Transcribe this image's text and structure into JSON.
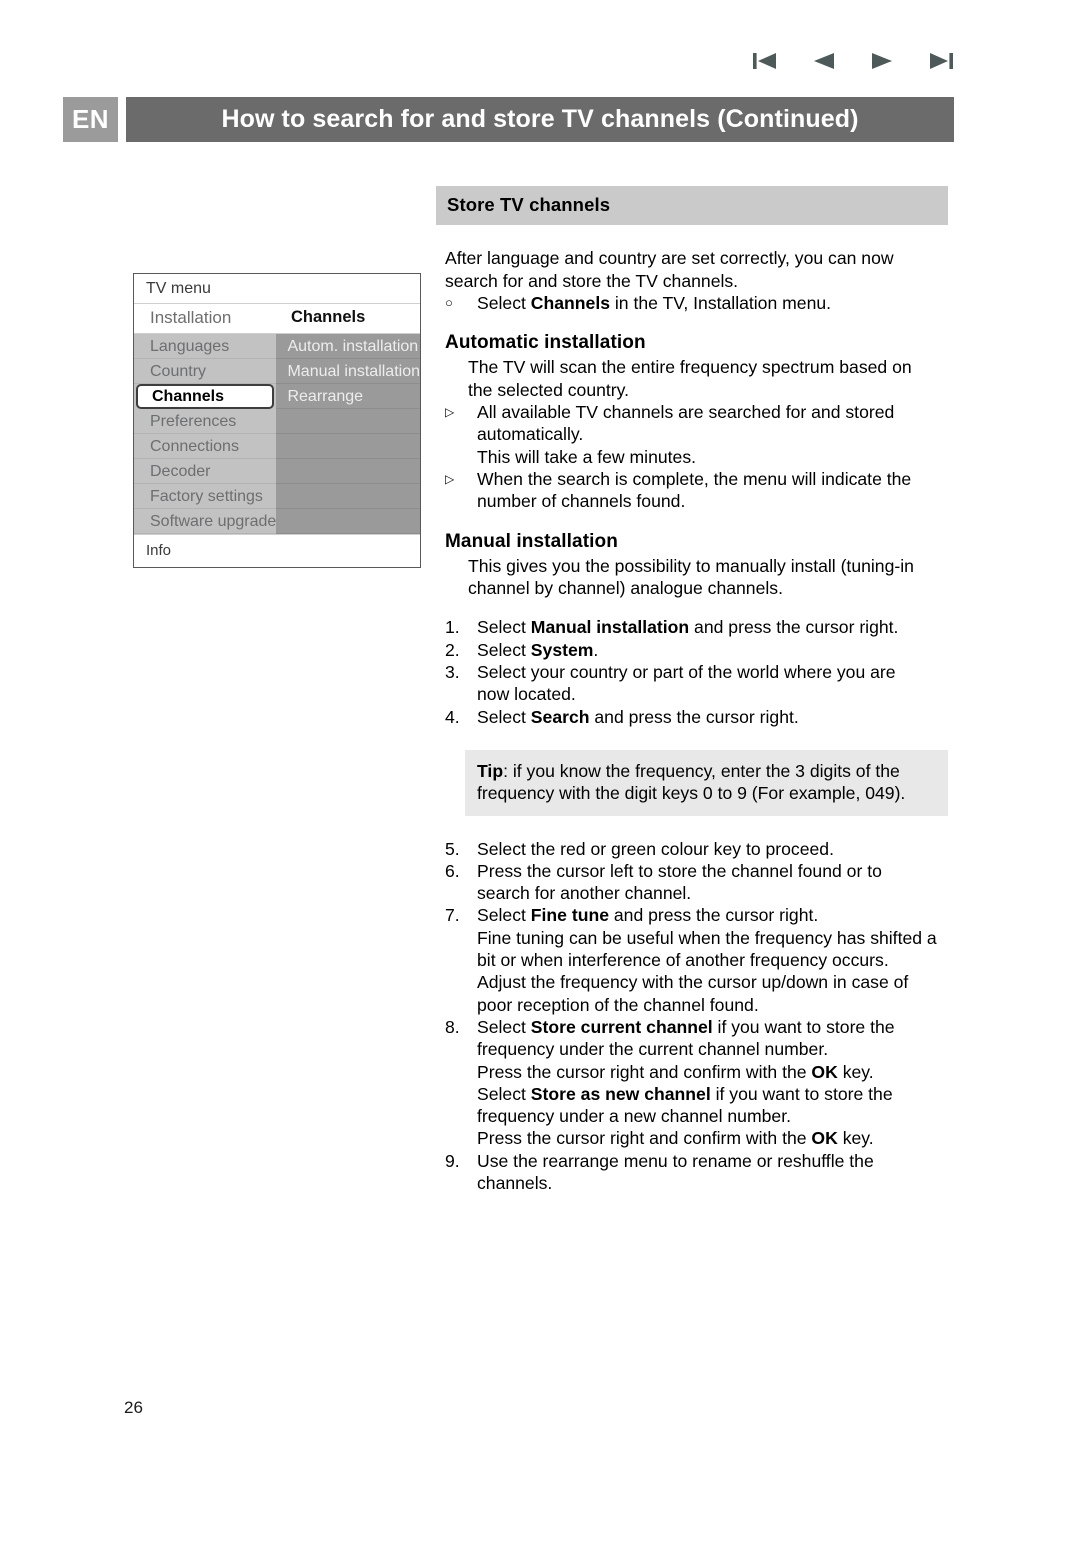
{
  "nav": {
    "items": [
      {
        "name": "first-page-icon",
        "label": "First page"
      },
      {
        "name": "previous-page-icon",
        "label": "Previous page"
      },
      {
        "name": "next-page-icon",
        "label": "Next page"
      },
      {
        "name": "last-page-icon",
        "label": "Last page"
      }
    ]
  },
  "header": {
    "language_badge": "EN",
    "title": "How to search for and store TV channels  (Continued)",
    "badge_color": "#9b9b9b",
    "bar_color": "#6b6b6b"
  },
  "tv_menu": {
    "title": "TV menu",
    "head_left": "Installation",
    "head_right": "Channels",
    "left_items": [
      {
        "label": "Languages",
        "selected": false
      },
      {
        "label": "Country",
        "selected": false
      },
      {
        "label": "Channels",
        "selected": true
      },
      {
        "label": "Preferences",
        "selected": false
      },
      {
        "label": "Connections",
        "selected": false
      },
      {
        "label": "Decoder",
        "selected": false
      },
      {
        "label": "Factory settings",
        "selected": false
      },
      {
        "label": "Software upgrade",
        "selected": false
      }
    ],
    "right_items": [
      {
        "label": "Autom. installation"
      },
      {
        "label": "Manual installation"
      },
      {
        "label": "Rearrange"
      },
      {
        "label": ""
      },
      {
        "label": ""
      },
      {
        "label": ""
      },
      {
        "label": ""
      },
      {
        "label": ""
      }
    ],
    "info": "Info",
    "left_bg": "#c2c2c2",
    "right_bg": "#9a9a9a"
  },
  "content": {
    "section_title": "Store TV channels",
    "section_bar_color": "#cacaca",
    "intro_line1": "After language and country are set correctly, you can now",
    "intro_line2": "search for and store the TV channels.",
    "intro_bullet_mark": "○",
    "intro_bullet_pre": "Select ",
    "intro_bullet_bold": "Channels",
    "intro_bullet_post": " in the TV, Installation menu.",
    "auto_heading": "Automatic installation",
    "auto_para_line1": "The TV will scan the entire frequency spectrum based on",
    "auto_para_line2": "the selected country.",
    "auto_bullets": [
      {
        "mark": "▷",
        "line1": "All available TV channels are searched for and stored",
        "line2": "automatically.",
        "line3": "This will take a few minutes."
      },
      {
        "mark": "▷",
        "line1": "When the search is complete, the menu will indicate the",
        "line2": "number of channels found.",
        "line3": ""
      }
    ],
    "manual_heading": "Manual installation",
    "manual_para_line1": "This gives you the possibility to manually install (tuning-in",
    "manual_para_line2": "channel by channel) analogue channels.",
    "steps_1_to_4": [
      {
        "num": "1.",
        "segments": [
          {
            "text": "Select ",
            "bold": false
          },
          {
            "text": "Manual installation",
            "bold": true
          },
          {
            "text": " and press the cursor right.",
            "bold": false
          }
        ]
      },
      {
        "num": "2.",
        "segments": [
          {
            "text": "Select ",
            "bold": false
          },
          {
            "text": "System",
            "bold": true
          },
          {
            "text": ".",
            "bold": false
          }
        ]
      },
      {
        "num": "3.",
        "segments": [
          {
            "text": "Select your country or part of the world where you are",
            "bold": false
          },
          {
            "text": "\n",
            "bold": false
          },
          {
            "text": "now located.",
            "bold": false
          }
        ]
      },
      {
        "num": "4.",
        "segments": [
          {
            "text": "Select ",
            "bold": false
          },
          {
            "text": "Search",
            "bold": true
          },
          {
            "text": " and press the cursor right.",
            "bold": false
          }
        ]
      }
    ],
    "tip": {
      "bold_label": "Tip",
      "line1_rest": ": if you know the frequency, enter the 3 digits of the",
      "line2": "frequency with the digit keys 0 to 9 (For example, 049).",
      "bg_color": "#e8e8e8"
    },
    "steps_5_to_9": [
      {
        "num": "5.",
        "lines": [
          [
            {
              "text": "Select the red or green colour key to proceed.",
              "bold": false
            }
          ]
        ]
      },
      {
        "num": "6.",
        "lines": [
          [
            {
              "text": "Press the cursor left to store the channel found or to",
              "bold": false
            }
          ],
          [
            {
              "text": "search for another channel.",
              "bold": false
            }
          ]
        ]
      },
      {
        "num": "7.",
        "lines": [
          [
            {
              "text": "Select ",
              "bold": false
            },
            {
              "text": "Fine tune",
              "bold": true
            },
            {
              "text": " and press the cursor right.",
              "bold": false
            }
          ],
          [
            {
              "text": "Fine tuning can be useful when the frequency has shifted a",
              "bold": false
            }
          ],
          [
            {
              "text": "bit or when interference of another frequency occurs.",
              "bold": false
            }
          ],
          [
            {
              "text": "Adjust the frequency with the cursor up/down in case of",
              "bold": false
            }
          ],
          [
            {
              "text": "poor reception of the channel found.",
              "bold": false
            }
          ]
        ]
      },
      {
        "num": "8.",
        "lines": [
          [
            {
              "text": "Select ",
              "bold": false
            },
            {
              "text": "Store current channel",
              "bold": true
            },
            {
              "text": " if you want to store the",
              "bold": false
            }
          ],
          [
            {
              "text": "frequency under the current channel number.",
              "bold": false
            }
          ],
          [
            {
              "text": "Press the cursor right and confirm with the ",
              "bold": false
            },
            {
              "text": "OK",
              "bold": true
            },
            {
              "text": " key.",
              "bold": false
            }
          ],
          [
            {
              "text": "Select ",
              "bold": false
            },
            {
              "text": "Store as new channel",
              "bold": true
            },
            {
              "text": " if you want to store the",
              "bold": false
            }
          ],
          [
            {
              "text": "frequency under a new channel number.",
              "bold": false
            }
          ],
          [
            {
              "text": "Press the cursor right and confirm with the ",
              "bold": false
            },
            {
              "text": "OK",
              "bold": true
            },
            {
              "text": " key.",
              "bold": false
            }
          ]
        ]
      },
      {
        "num": "9.",
        "lines": [
          [
            {
              "text": "Use the rearrange menu to rename or reshuffle the",
              "bold": false
            }
          ],
          [
            {
              "text": "channels.",
              "bold": false
            }
          ]
        ]
      }
    ]
  },
  "footer": {
    "page_number": "26"
  }
}
